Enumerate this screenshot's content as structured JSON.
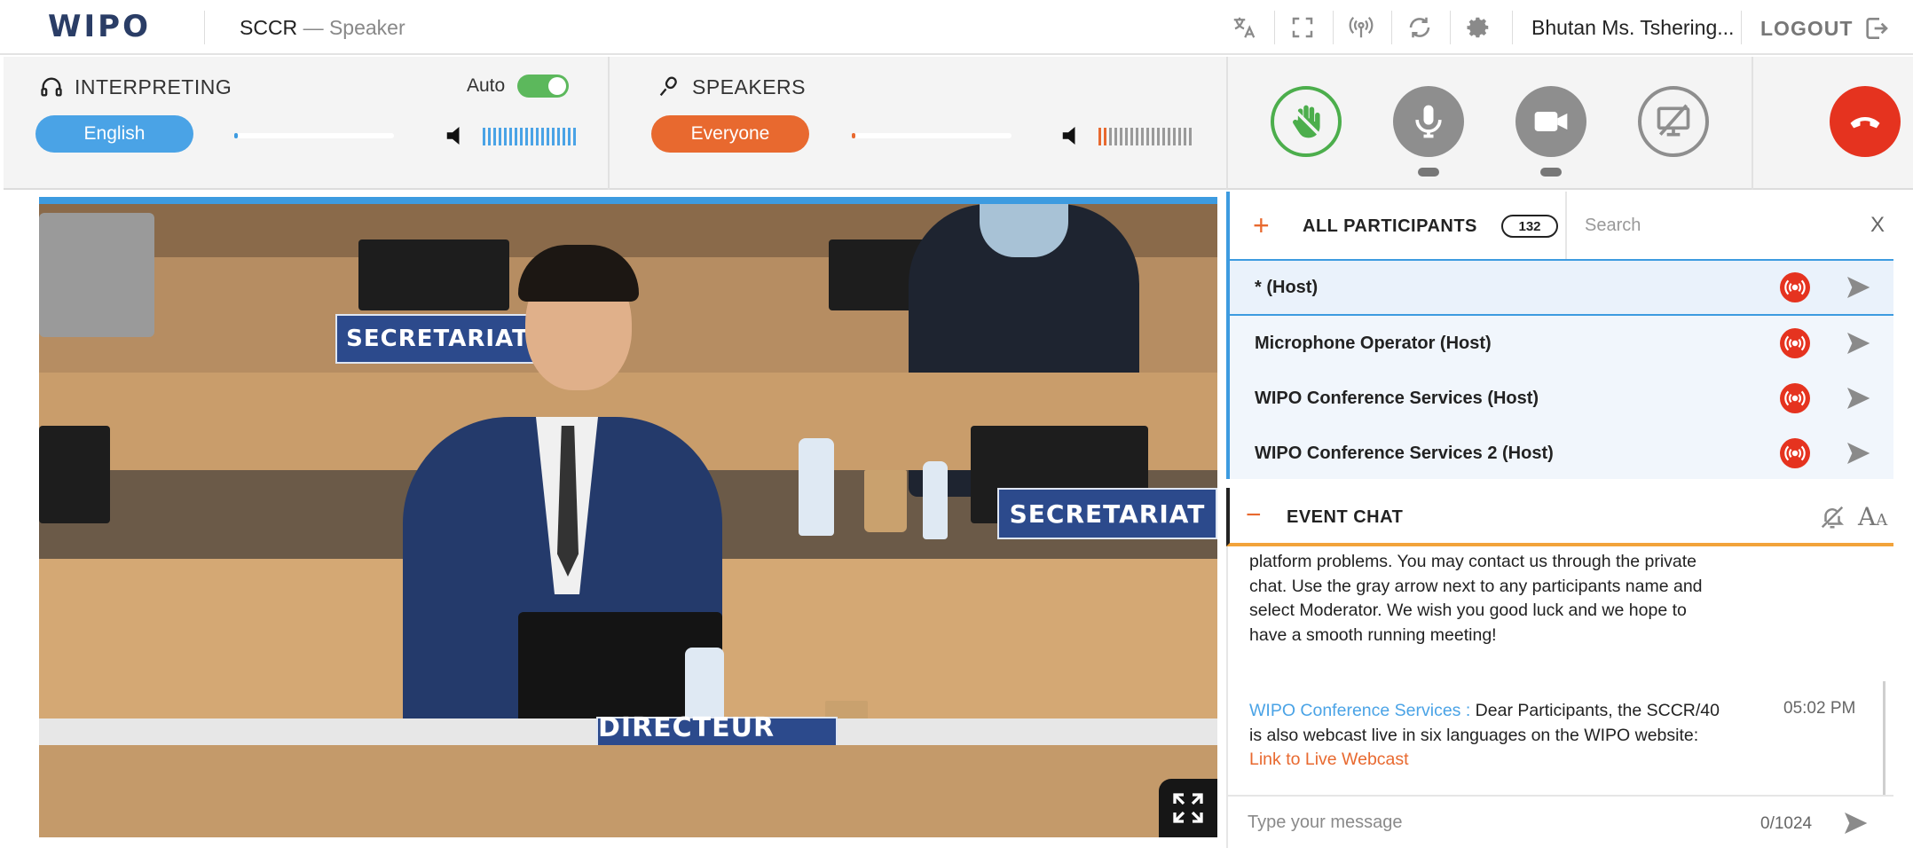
{
  "header": {
    "logo": "WIPO",
    "title": "SCCR",
    "role": "— Speaker",
    "user_name": "Bhutan Ms. Tshering...",
    "logout_label": "LOGOUT"
  },
  "interpreting": {
    "heading": "INTERPRETING",
    "auto_label": "Auto",
    "auto_on": true,
    "language": "English",
    "volume": 0
  },
  "speakers": {
    "heading": "SPEAKERS",
    "selection": "Everyone",
    "volume": 0.02
  },
  "video": {
    "nameplate_left": "SECRETARIAT",
    "nameplate_right": "SECRETARIAT",
    "nameplate_center": "DIRECTEUR GENERAL"
  },
  "participants": {
    "heading": "ALL PARTICIPANTS",
    "count": "132",
    "search_placeholder": "Search",
    "close_label": "X",
    "items": [
      {
        "name": "* (Host)"
      },
      {
        "name": "Microphone Operator (Host)"
      },
      {
        "name": "WIPO Conference Services (Host)"
      },
      {
        "name": "WIPO Conference Services 2 (Host)"
      }
    ]
  },
  "chat": {
    "heading": "EVENT CHAT",
    "fontsize_label": "A",
    "fontsize_small": "A",
    "message1_text": "platform problems. You may contact us through the private chat. Use the gray arrow next to any participants name and select Moderator. We wish you good luck and we hope to have a smooth running meeting!",
    "message2_sender": "WIPO Conference Services :",
    "message2_text": " Dear Participants, the SCCR/40 is also webcast live in six languages on the WIPO website: ",
    "message2_link": "Link to Live Webcast",
    "message2_time": "05:02 PM",
    "input_placeholder": "Type your message",
    "char_count": "0/1024"
  },
  "colors": {
    "accent_blue": "#3d9be0",
    "accent_orange": "#e8692f",
    "hand_green": "#4cae4c",
    "end_call_red": "#e5331f"
  }
}
